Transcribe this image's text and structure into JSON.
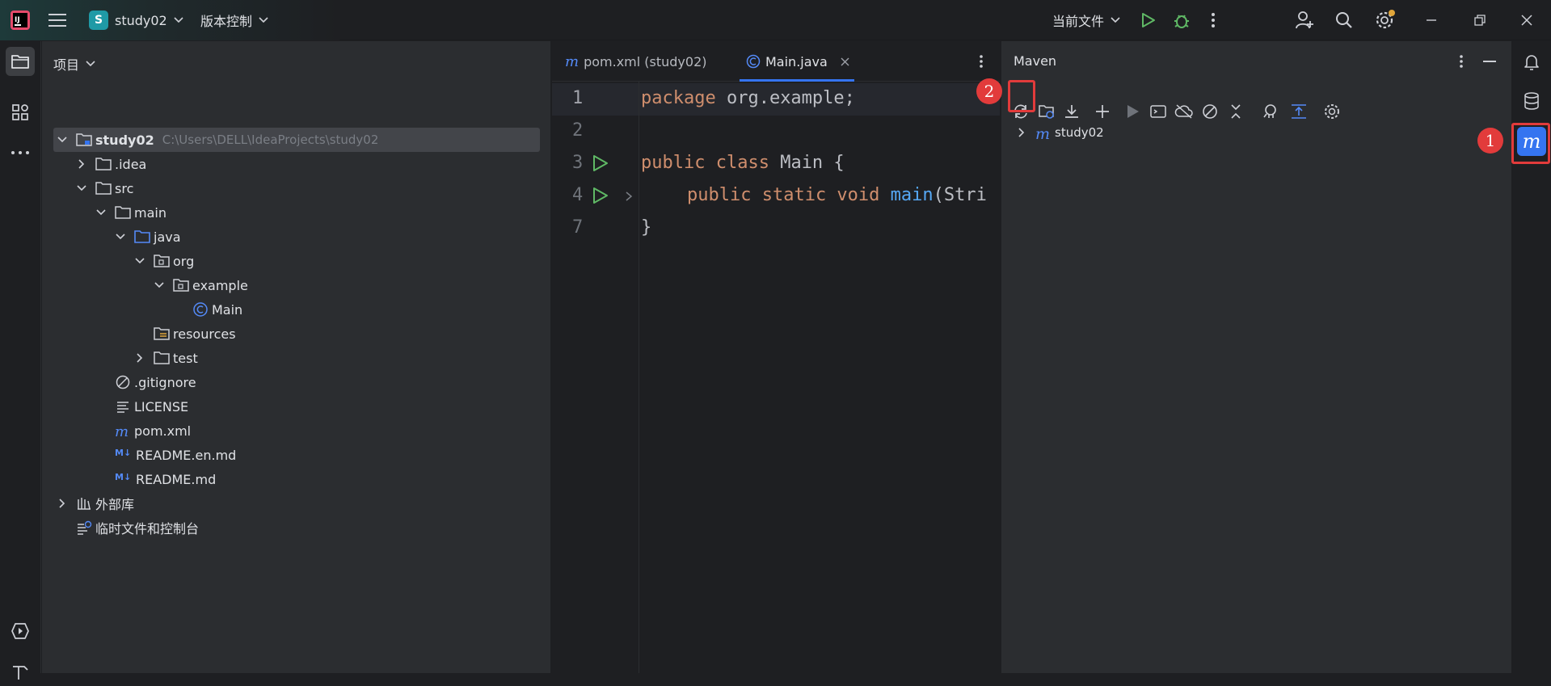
{
  "titlebar": {
    "project_chip": "S",
    "project_name": "study02",
    "vcs_label": "版本控制",
    "run_config": "当前文件"
  },
  "project_panel": {
    "title": "项目",
    "tree": [
      {
        "label": "study02",
        "path": "C:\\Users\\DELL\\IdeaProjects\\study02"
      },
      {
        "label": ".idea"
      },
      {
        "label": "src"
      },
      {
        "label": "main"
      },
      {
        "label": "java"
      },
      {
        "label": "org"
      },
      {
        "label": "example"
      },
      {
        "label": "Main"
      },
      {
        "label": "resources"
      },
      {
        "label": "test"
      },
      {
        "label": ".gitignore"
      },
      {
        "label": "LICENSE"
      },
      {
        "label": "pom.xml"
      },
      {
        "label": "README.en.md"
      },
      {
        "label": "README.md"
      },
      {
        "label": "外部库"
      },
      {
        "label": "临时文件和控制台"
      }
    ]
  },
  "editor": {
    "tabs": [
      {
        "label": "pom.xml (study02)",
        "active": false
      },
      {
        "label": "Main.java",
        "active": true
      }
    ],
    "line_numbers": [
      "1",
      "2",
      "3",
      "4",
      "7"
    ],
    "code": {
      "l1_kw": "package",
      "l1_rest": " org.example;",
      "l3_kw": "public class",
      "l3_rest": " Main {",
      "l4_kw": "public static void",
      "l4_fn": "main",
      "l4_rest": "(Stri",
      "l7": "}"
    }
  },
  "maven": {
    "title": "Maven",
    "tree": [
      {
        "label": "study02"
      }
    ]
  },
  "annotations": {
    "badge1": "1",
    "badge2": "2"
  },
  "colors": {
    "accent": "#3574f0",
    "annotation": "#e23b3b",
    "run": "#5fb865"
  }
}
